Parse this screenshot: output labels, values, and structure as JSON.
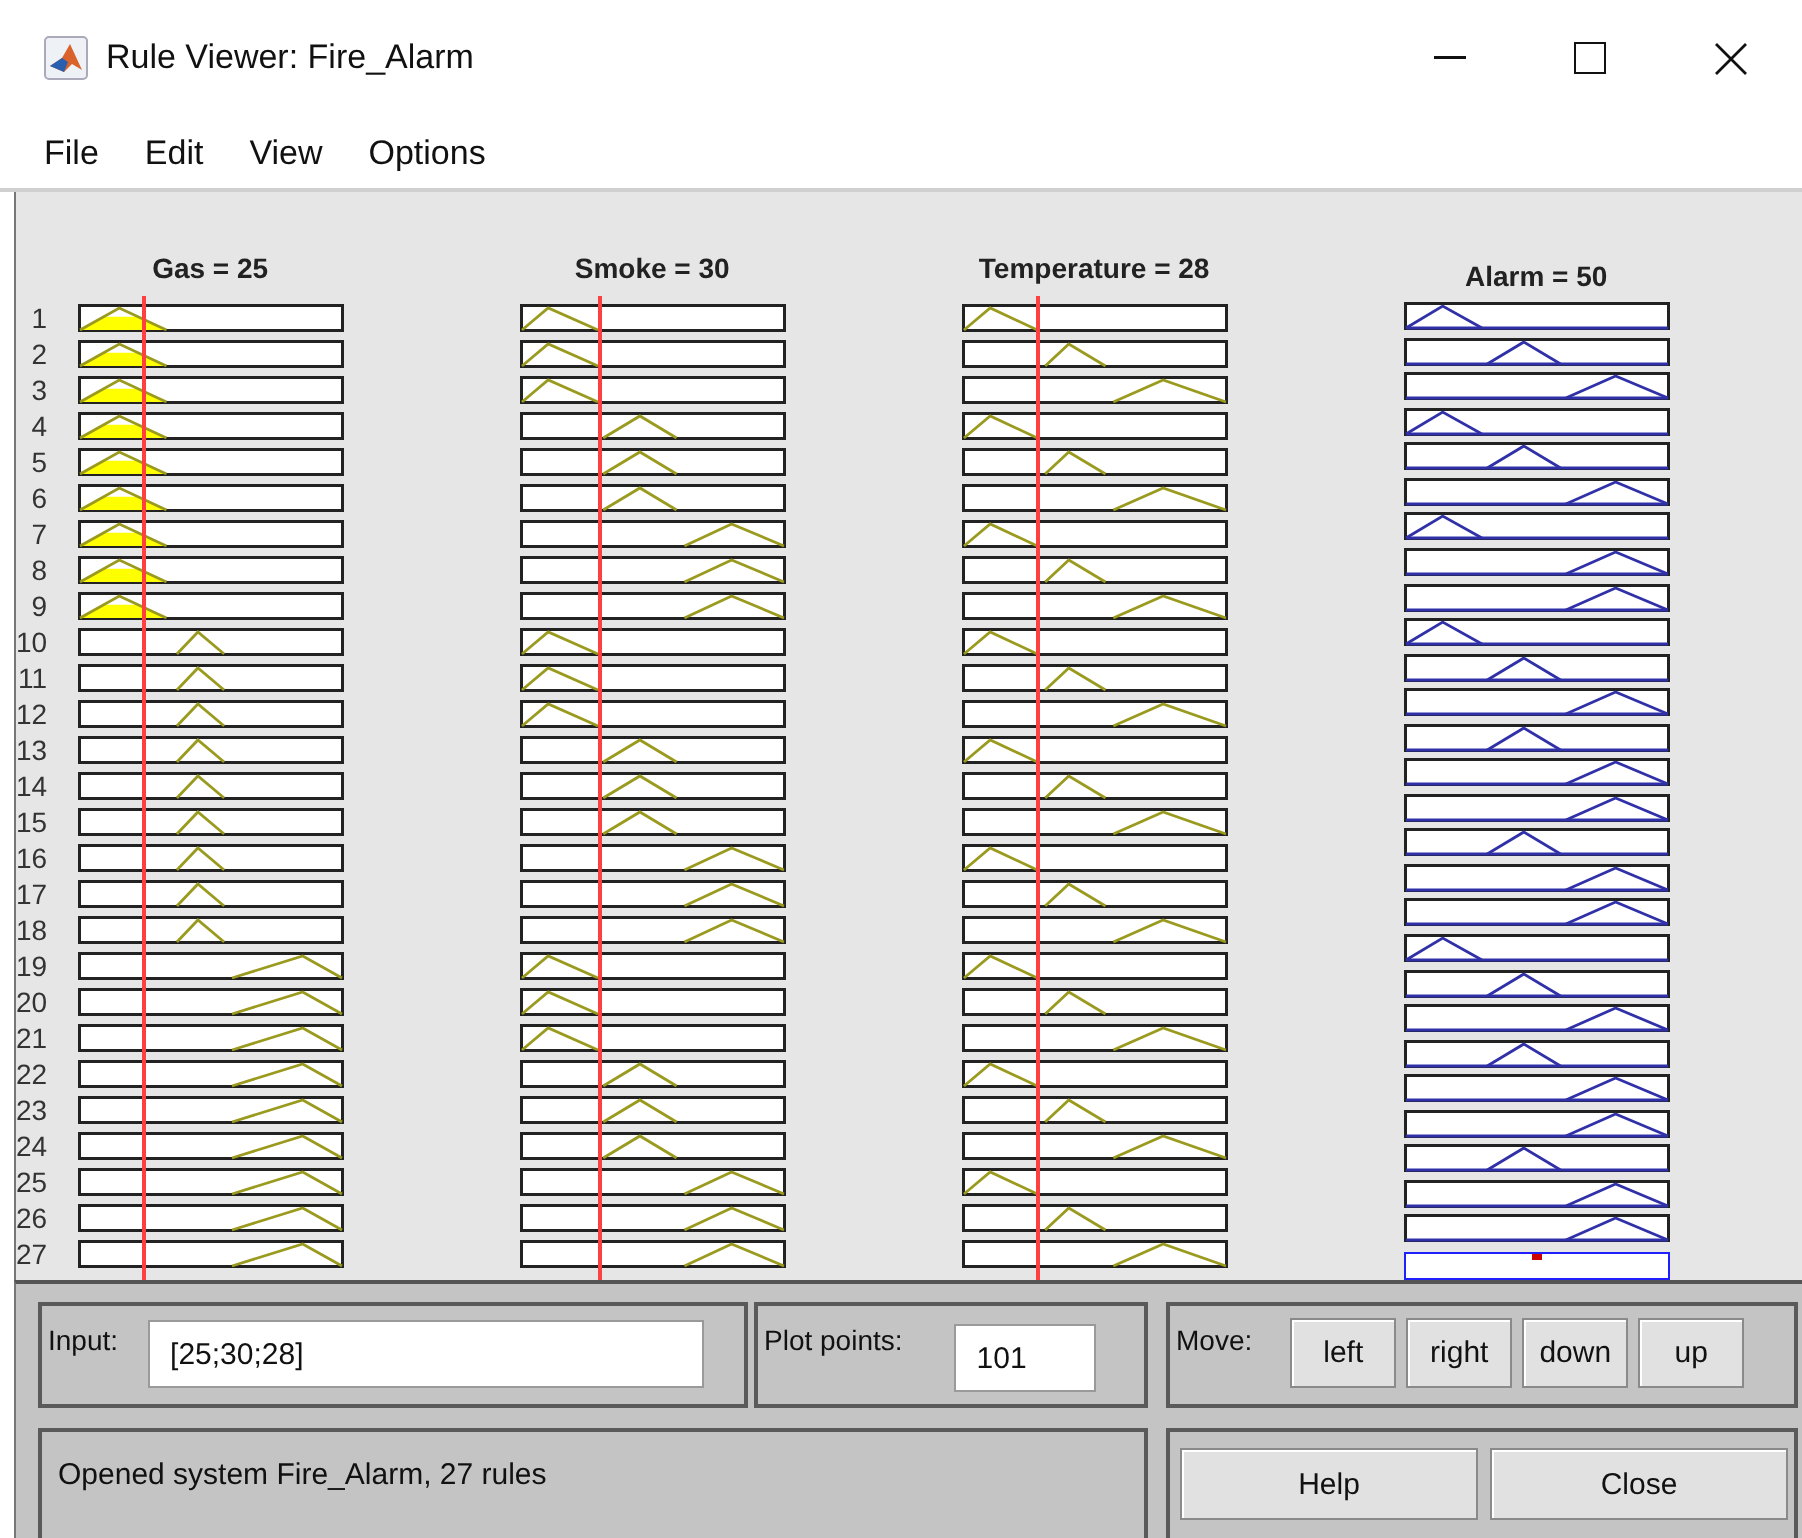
{
  "window": {
    "title": "Rule Viewer: Fire_Alarm"
  },
  "menu": [
    {
      "label": "File"
    },
    {
      "label": "Edit"
    },
    {
      "label": "View"
    },
    {
      "label": "Options"
    }
  ],
  "variables": [
    {
      "header": "Gas = 25",
      "kind": "input"
    },
    {
      "header": "Smoke = 30",
      "kind": "input"
    },
    {
      "header": "Temperature = 28",
      "kind": "input"
    },
    {
      "header": "Alarm = 50",
      "kind": "output"
    }
  ],
  "rules": [
    {
      "number": "1",
      "cells": [
        {
          "kind": "low",
          "fired": true
        },
        {
          "kind": "low",
          "fired": false
        },
        {
          "kind": "low",
          "fired": false
        },
        {
          "kind": "low",
          "fired": false
        }
      ]
    },
    {
      "number": "2",
      "cells": [
        {
          "kind": "low",
          "fired": true
        },
        {
          "kind": "low",
          "fired": false
        },
        {
          "kind": "mid",
          "fired": false
        },
        {
          "kind": "mid",
          "fired": false
        }
      ]
    },
    {
      "number": "3",
      "cells": [
        {
          "kind": "low",
          "fired": true
        },
        {
          "kind": "low",
          "fired": false
        },
        {
          "kind": "high",
          "fired": false
        },
        {
          "kind": "high",
          "fired": false
        }
      ]
    },
    {
      "number": "4",
      "cells": [
        {
          "kind": "low",
          "fired": true
        },
        {
          "kind": "mid",
          "fired": false
        },
        {
          "kind": "low",
          "fired": false
        },
        {
          "kind": "low",
          "fired": false
        }
      ]
    },
    {
      "number": "5",
      "cells": [
        {
          "kind": "low",
          "fired": true
        },
        {
          "kind": "mid",
          "fired": false
        },
        {
          "kind": "mid",
          "fired": false
        },
        {
          "kind": "mid",
          "fired": false
        }
      ]
    },
    {
      "number": "6",
      "cells": [
        {
          "kind": "low",
          "fired": true
        },
        {
          "kind": "mid",
          "fired": false
        },
        {
          "kind": "high",
          "fired": false
        },
        {
          "kind": "high",
          "fired": false
        }
      ]
    },
    {
      "number": "7",
      "cells": [
        {
          "kind": "low",
          "fired": true
        },
        {
          "kind": "high",
          "fired": false
        },
        {
          "kind": "low",
          "fired": false
        },
        {
          "kind": "low",
          "fired": false
        }
      ]
    },
    {
      "number": "8",
      "cells": [
        {
          "kind": "low",
          "fired": true
        },
        {
          "kind": "high",
          "fired": false
        },
        {
          "kind": "mid",
          "fired": false
        },
        {
          "kind": "high",
          "fired": false
        }
      ]
    },
    {
      "number": "9",
      "cells": [
        {
          "kind": "low",
          "fired": true
        },
        {
          "kind": "high",
          "fired": false
        },
        {
          "kind": "high",
          "fired": false
        },
        {
          "kind": "high",
          "fired": false
        }
      ]
    },
    {
      "number": "10",
      "cells": [
        {
          "kind": "mid",
          "fired": false
        },
        {
          "kind": "low",
          "fired": false
        },
        {
          "kind": "low",
          "fired": false
        },
        {
          "kind": "low",
          "fired": false
        }
      ]
    },
    {
      "number": "11",
      "cells": [
        {
          "kind": "mid",
          "fired": false
        },
        {
          "kind": "low",
          "fired": false
        },
        {
          "kind": "mid",
          "fired": false
        },
        {
          "kind": "mid",
          "fired": false
        }
      ]
    },
    {
      "number": "12",
      "cells": [
        {
          "kind": "mid",
          "fired": false
        },
        {
          "kind": "low",
          "fired": false
        },
        {
          "kind": "high",
          "fired": false
        },
        {
          "kind": "high",
          "fired": false
        }
      ]
    },
    {
      "number": "13",
      "cells": [
        {
          "kind": "mid",
          "fired": false
        },
        {
          "kind": "mid",
          "fired": false
        },
        {
          "kind": "low",
          "fired": false
        },
        {
          "kind": "mid",
          "fired": false
        }
      ]
    },
    {
      "number": "14",
      "cells": [
        {
          "kind": "mid",
          "fired": false
        },
        {
          "kind": "mid",
          "fired": false
        },
        {
          "kind": "mid",
          "fired": false
        },
        {
          "kind": "high",
          "fired": false
        }
      ]
    },
    {
      "number": "15",
      "cells": [
        {
          "kind": "mid",
          "fired": false
        },
        {
          "kind": "mid",
          "fired": false
        },
        {
          "kind": "high",
          "fired": false
        },
        {
          "kind": "high",
          "fired": false
        }
      ]
    },
    {
      "number": "16",
      "cells": [
        {
          "kind": "mid",
          "fired": false
        },
        {
          "kind": "high",
          "fired": false
        },
        {
          "kind": "low",
          "fired": false
        },
        {
          "kind": "mid",
          "fired": false
        }
      ]
    },
    {
      "number": "17",
      "cells": [
        {
          "kind": "mid",
          "fired": false
        },
        {
          "kind": "high",
          "fired": false
        },
        {
          "kind": "mid",
          "fired": false
        },
        {
          "kind": "high",
          "fired": false
        }
      ]
    },
    {
      "number": "18",
      "cells": [
        {
          "kind": "mid",
          "fired": false
        },
        {
          "kind": "high",
          "fired": false
        },
        {
          "kind": "high",
          "fired": false
        },
        {
          "kind": "high",
          "fired": false
        }
      ]
    },
    {
      "number": "19",
      "cells": [
        {
          "kind": "high",
          "fired": false
        },
        {
          "kind": "low",
          "fired": false
        },
        {
          "kind": "low",
          "fired": false
        },
        {
          "kind": "low",
          "fired": false
        }
      ]
    },
    {
      "number": "20",
      "cells": [
        {
          "kind": "high",
          "fired": false
        },
        {
          "kind": "low",
          "fired": false
        },
        {
          "kind": "mid",
          "fired": false
        },
        {
          "kind": "mid",
          "fired": false
        }
      ]
    },
    {
      "number": "21",
      "cells": [
        {
          "kind": "high",
          "fired": false
        },
        {
          "kind": "low",
          "fired": false
        },
        {
          "kind": "high",
          "fired": false
        },
        {
          "kind": "high",
          "fired": false
        }
      ]
    },
    {
      "number": "22",
      "cells": [
        {
          "kind": "high",
          "fired": false
        },
        {
          "kind": "mid",
          "fired": false
        },
        {
          "kind": "low",
          "fired": false
        },
        {
          "kind": "mid",
          "fired": false
        }
      ]
    },
    {
      "number": "23",
      "cells": [
        {
          "kind": "high",
          "fired": false
        },
        {
          "kind": "mid",
          "fired": false
        },
        {
          "kind": "mid",
          "fired": false
        },
        {
          "kind": "high",
          "fired": false
        }
      ]
    },
    {
      "number": "24",
      "cells": [
        {
          "kind": "high",
          "fired": false
        },
        {
          "kind": "mid",
          "fired": false
        },
        {
          "kind": "high",
          "fired": false
        },
        {
          "kind": "high",
          "fired": false
        }
      ]
    },
    {
      "number": "25",
      "cells": [
        {
          "kind": "high",
          "fired": false
        },
        {
          "kind": "high",
          "fired": false
        },
        {
          "kind": "low",
          "fired": false
        },
        {
          "kind": "mid",
          "fired": false
        }
      ]
    },
    {
      "number": "26",
      "cells": [
        {
          "kind": "high",
          "fired": false
        },
        {
          "kind": "high",
          "fired": false
        },
        {
          "kind": "mid",
          "fired": false
        },
        {
          "kind": "high",
          "fired": false
        }
      ]
    },
    {
      "number": "27",
      "cells": [
        {
          "kind": "high",
          "fired": false
        },
        {
          "kind": "high",
          "fired": false
        },
        {
          "kind": "high",
          "fired": false
        },
        {
          "kind": "high",
          "fired": false
        }
      ]
    }
  ],
  "input": {
    "label": "Input:",
    "value": "[25;30;28]"
  },
  "plot_points": {
    "label": "Plot points:",
    "value": "101"
  },
  "move": {
    "label": "Move:",
    "buttons": [
      "left",
      "right",
      "down",
      "up"
    ]
  },
  "status": "Opened system Fire_Alarm, 27 rules",
  "buttons": [
    "Help",
    "Close"
  ]
}
